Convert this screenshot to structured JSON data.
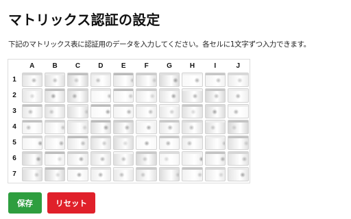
{
  "page": {
    "title": "マトリックス認証の設定",
    "description": "下記のマトリックス表に認証用のデータを入力してください。各セルに1文字ずつ入力できます。"
  },
  "matrix": {
    "columns": [
      "A",
      "B",
      "C",
      "D",
      "E",
      "F",
      "G",
      "H",
      "I",
      "J"
    ],
    "rows": [
      "1",
      "2",
      "3",
      "4",
      "5",
      "6",
      "7"
    ],
    "cell_values": [
      [
        "",
        "",
        "",
        "",
        "",
        "",
        "",
        "",
        "",
        ""
      ],
      [
        "",
        "",
        "",
        "",
        "",
        "",
        "",
        "",
        "",
        ""
      ],
      [
        "",
        "",
        "",
        "",
        "",
        "",
        "",
        "",
        "",
        ""
      ],
      [
        "",
        "",
        "",
        "",
        "",
        "",
        "",
        "",
        "",
        ""
      ],
      [
        "",
        "",
        "",
        "",
        "",
        "",
        "",
        "",
        "",
        ""
      ],
      [
        "",
        "",
        "",
        "",
        "",
        "",
        "",
        "",
        "",
        ""
      ],
      [
        "",
        "",
        "",
        "",
        "",
        "",
        "",
        "",
        "",
        ""
      ]
    ]
  },
  "buttons": {
    "save": {
      "label": "保存",
      "color": "#2e9e3f"
    },
    "reset": {
      "label": "リセット",
      "color": "#e0202a"
    }
  }
}
